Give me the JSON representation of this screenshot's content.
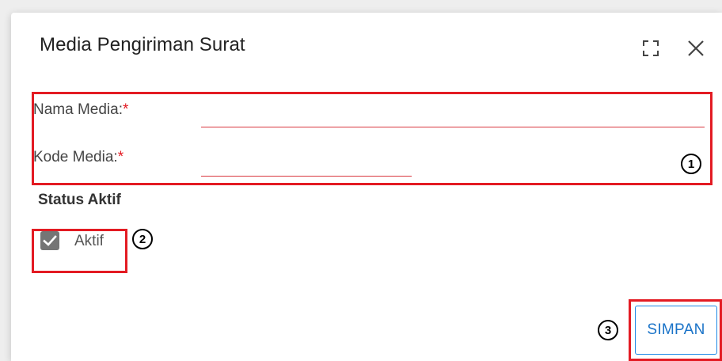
{
  "dialog": {
    "title": "Media Pengiriman Surat",
    "icons": [
      "maximize-icon",
      "close-icon"
    ]
  },
  "form": {
    "nama_media": {
      "label": "Nama Media:",
      "required_mark": "*",
      "value": ""
    },
    "kode_media": {
      "label": "Kode Media:",
      "required_mark": "*",
      "value": ""
    }
  },
  "status": {
    "title": "Status Aktif",
    "checkbox_label": "Aktif",
    "checked": true
  },
  "actions": {
    "save_label": "SIMPAN"
  },
  "annotations": {
    "marker_1": "1",
    "marker_2": "2",
    "marker_3": "3"
  },
  "colors": {
    "annotation": "#e31b23",
    "accent": "#1e88e5",
    "checkbox": "#757575"
  }
}
